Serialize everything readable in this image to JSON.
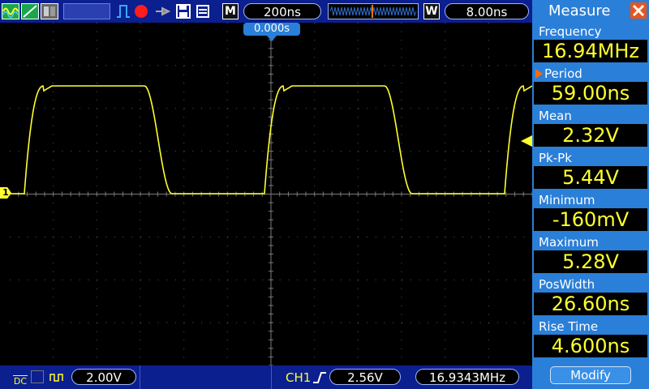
{
  "top": {
    "timebase": "200ns",
    "mode_letter": "M",
    "window_letter": "W",
    "window_value": "8.00ns",
    "trigger_time": "0.000s"
  },
  "bottom": {
    "coupling": "DC",
    "ch1_scale": "2.00V",
    "trig_source": "CH1",
    "trig_level": "2.56V",
    "freq_counter": "16.9343MHz"
  },
  "channel_marker": "1",
  "measure": {
    "title": "Measure",
    "items": [
      {
        "label": "Frequency",
        "value": "16.94MHz",
        "selected": false
      },
      {
        "label": "Period",
        "value": "59.00ns",
        "selected": true
      },
      {
        "label": "Mean",
        "value": "2.32V",
        "selected": false
      },
      {
        "label": "Pk-Pk",
        "value": "5.44V",
        "selected": false
      },
      {
        "label": "Minimum",
        "value": "-160mV",
        "selected": false
      },
      {
        "label": "Maximum",
        "value": "5.28V",
        "selected": false
      },
      {
        "label": "PosWidth",
        "value": "26.60ns",
        "selected": false
      },
      {
        "label": "Rise Time",
        "value": "4.600ns",
        "selected": false
      }
    ],
    "modify_label": "Modify"
  },
  "colors": {
    "trace": "#ffff2e",
    "panel": "#2a7fd8",
    "bar": "#0b1f8f",
    "close": "#e8541c",
    "selected_arrow": "#ff6a00"
  }
}
